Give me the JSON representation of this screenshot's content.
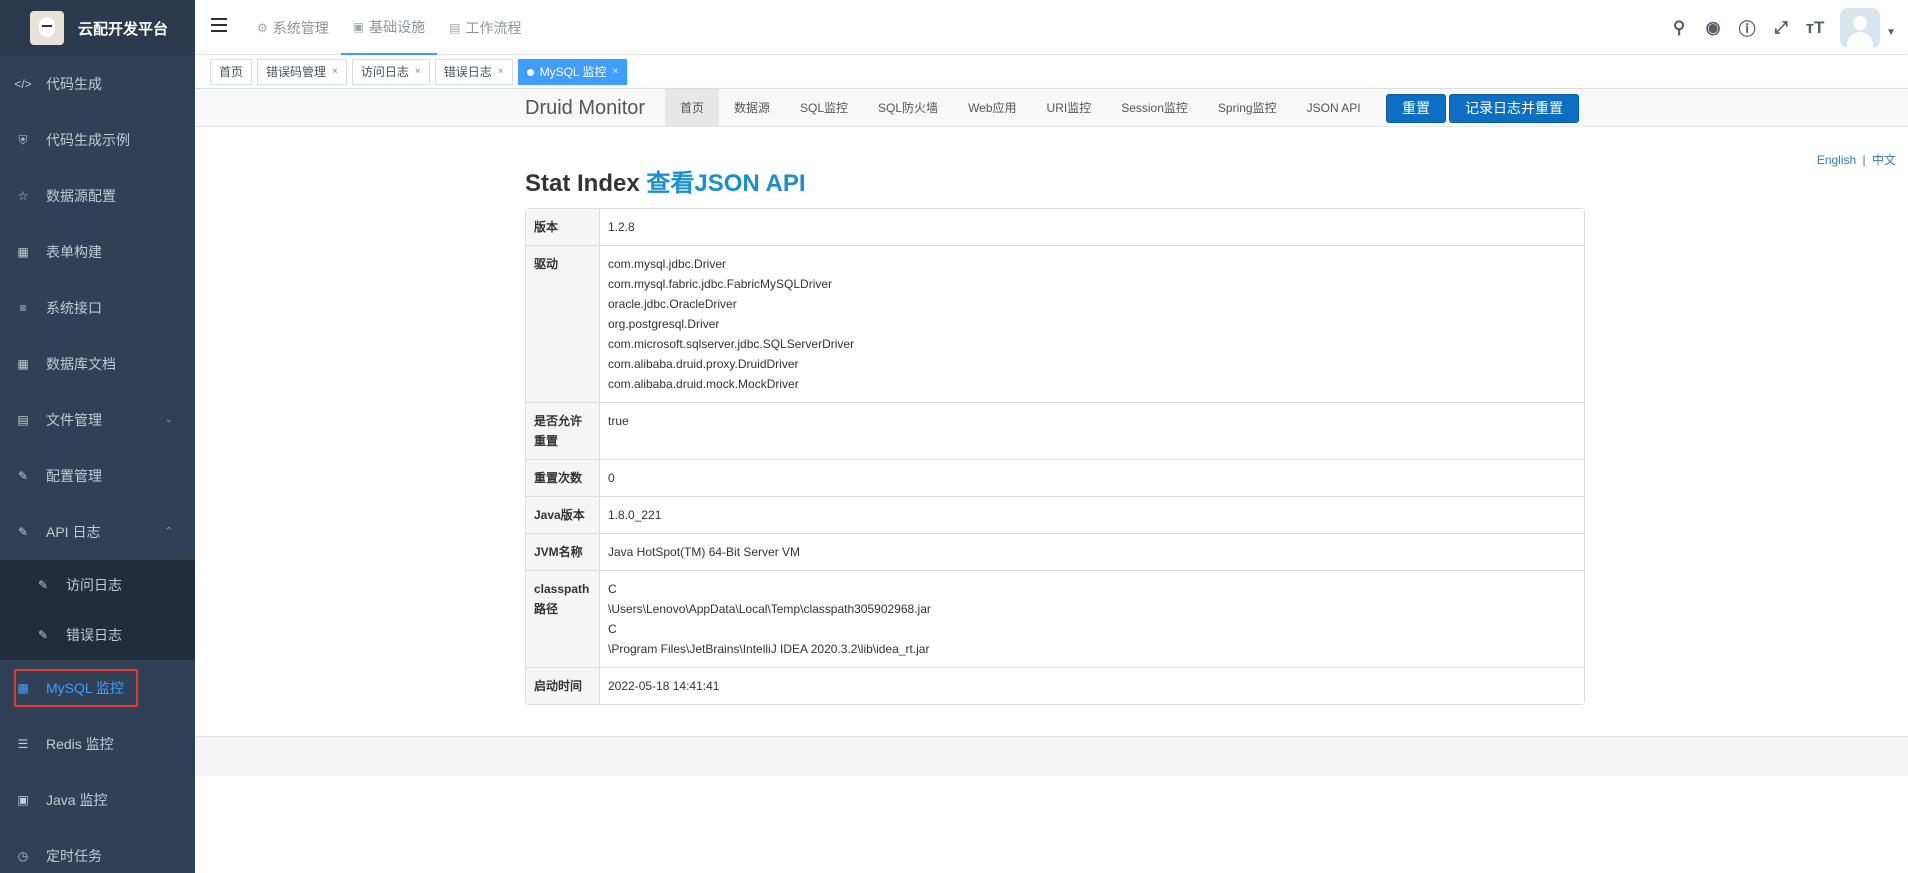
{
  "sidebar": {
    "title": "云配开发平台",
    "items": [
      {
        "label": "代码生成",
        "icon": "code-icon"
      },
      {
        "label": "代码生成示例",
        "icon": "shield-icon"
      },
      {
        "label": "数据源配置",
        "icon": "star-icon"
      },
      {
        "label": "表单构建",
        "icon": "form-icon"
      },
      {
        "label": "系统接口",
        "icon": "sliders-icon"
      },
      {
        "label": "数据库文档",
        "icon": "grid-icon"
      },
      {
        "label": "文件管理",
        "icon": "file-icon"
      },
      {
        "label": "配置管理",
        "icon": "edit-icon"
      },
      {
        "label": "API 日志",
        "icon": "edit-icon"
      }
    ],
    "sub_items": [
      {
        "label": "访问日志",
        "icon": "edit-icon"
      },
      {
        "label": "错误日志",
        "icon": "edit-icon"
      }
    ],
    "items_after": [
      {
        "label": "MySQL 监控",
        "icon": "monitor-icon",
        "active": true
      },
      {
        "label": "Redis 监控",
        "icon": "layers-icon"
      },
      {
        "label": "Java 监控",
        "icon": "screen-icon"
      },
      {
        "label": "定时任务",
        "icon": "clock-icon"
      }
    ],
    "active_color": "#409eff"
  },
  "navbar": {
    "tabs": [
      {
        "label": "系统管理",
        "icon": "gear-icon"
      },
      {
        "label": "基础设施",
        "icon": "monitor-icon",
        "active": true
      },
      {
        "label": "工作流程",
        "icon": "briefcase-icon"
      }
    ],
    "tools": [
      "search-icon",
      "github-icon",
      "question-icon",
      "fullscreen-icon",
      "font-size-icon"
    ]
  },
  "tags": [
    {
      "label": "首页",
      "closable": false
    },
    {
      "label": "错误码管理",
      "closable": true
    },
    {
      "label": "访问日志",
      "closable": true
    },
    {
      "label": "错误日志",
      "closable": true
    },
    {
      "label": "MySQL 监控",
      "closable": true,
      "active": true
    }
  ],
  "druid": {
    "brand": "Druid Monitor",
    "menu": [
      "首页",
      "数据源",
      "SQL监控",
      "SQL防火墙",
      "Web应用",
      "URI监控",
      "Session监控",
      "Spring监控",
      "JSON API"
    ],
    "buttons": [
      "重置",
      "记录日志并重置"
    ],
    "lang": {
      "english": "English",
      "sep": "|",
      "chinese": "中文"
    },
    "title": "Stat Index",
    "title_link": "查看JSON API",
    "rows": [
      {
        "label": "版本",
        "values": [
          "1.2.8"
        ]
      },
      {
        "label": "驱动",
        "values": [
          "com.mysql.jdbc.Driver",
          "com.mysql.fabric.jdbc.FabricMySQLDriver",
          "oracle.jdbc.OracleDriver",
          "org.postgresql.Driver",
          "com.microsoft.sqlserver.jdbc.SQLServerDriver",
          "com.alibaba.druid.proxy.DruidDriver",
          "com.alibaba.druid.mock.MockDriver"
        ]
      },
      {
        "label": "是否允许重置",
        "values": [
          "true"
        ]
      },
      {
        "label": "重置次数",
        "values": [
          "0"
        ]
      },
      {
        "label": "Java版本",
        "values": [
          "1.8.0_221"
        ]
      },
      {
        "label": "JVM名称",
        "values": [
          "Java HotSpot(TM) 64-Bit Server VM"
        ]
      },
      {
        "label": "classpath路径",
        "values": [
          "C",
          "\\Users\\Lenovo\\AppData\\Local\\Temp\\classpath305902968.jar",
          "C",
          "\\Program Files\\JetBrains\\IntelliJ IDEA 2020.3.2\\lib\\idea_rt.jar"
        ]
      },
      {
        "label": "启动时间",
        "values": [
          "2022-05-18 14:41:41"
        ]
      }
    ]
  }
}
